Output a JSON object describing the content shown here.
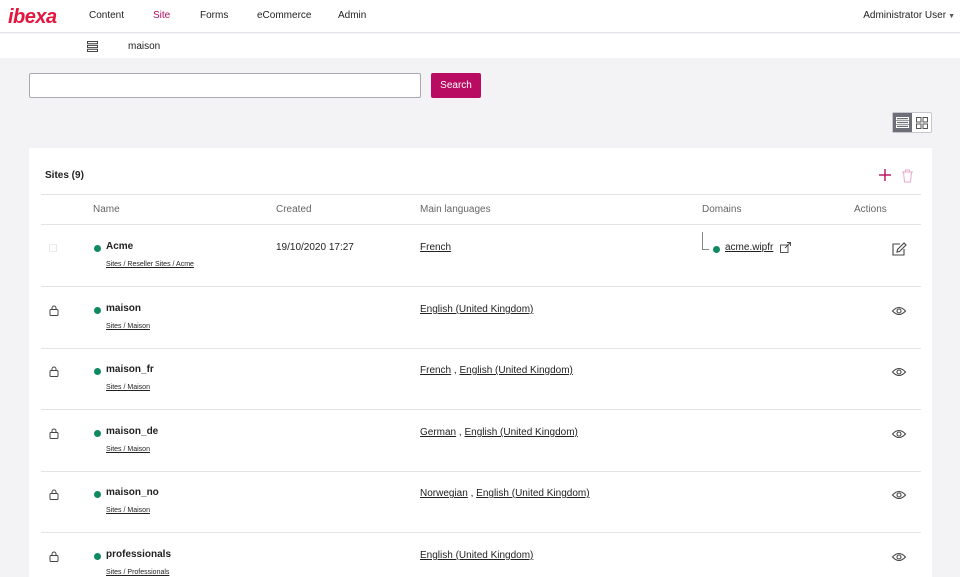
{
  "app": {
    "logo": "ibexa"
  },
  "nav": {
    "items": [
      {
        "label": "Content",
        "active": false
      },
      {
        "label": "Site",
        "active": true
      },
      {
        "label": "Forms",
        "active": false
      },
      {
        "label": "eCommerce",
        "active": false
      },
      {
        "label": "Admin",
        "active": false
      }
    ],
    "user": "Administrator User"
  },
  "breadcrumb": {
    "icon": "site-tree-icon",
    "text": "maison"
  },
  "search": {
    "value": "",
    "placeholder": "",
    "button_label": "Search"
  },
  "view_switch": {
    "active": "list",
    "options": [
      "list",
      "grid"
    ]
  },
  "colors": {
    "accent": "#b80b61",
    "logo": "#e3173e",
    "status": "#0f8a5f"
  },
  "sites": {
    "title": "Sites (9)",
    "columns": [
      "Name",
      "Created",
      "Main languages",
      "Domains",
      "Actions"
    ],
    "rows": [
      {
        "name": "Acme",
        "path": "Sites / Reseller Sites / Acme",
        "created": "19/10/2020 17:27",
        "languages": [
          "French"
        ],
        "domain": "acme.wipfr",
        "row_icon": "checkbox",
        "action": "edit-icon"
      },
      {
        "name": "maison",
        "path": "Sites / Maison",
        "created": "",
        "languages": [
          "English (United Kingdom)"
        ],
        "domain": "",
        "row_icon": "lock-icon",
        "action": "view-icon"
      },
      {
        "name": "maison_fr",
        "path": "Sites / Maison",
        "created": "",
        "languages": [
          "French",
          "English (United Kingdom)"
        ],
        "domain": "",
        "row_icon": "lock-icon",
        "action": "view-icon"
      },
      {
        "name": "maison_de",
        "path": "Sites / Maison",
        "created": "",
        "languages": [
          "German",
          "English (United Kingdom)"
        ],
        "domain": "",
        "row_icon": "lock-icon",
        "action": "view-icon"
      },
      {
        "name": "maison_no",
        "path": "Sites / Maison",
        "created": "",
        "languages": [
          "Norwegian",
          "English (United Kingdom)"
        ],
        "domain": "",
        "row_icon": "lock-icon",
        "action": "view-icon"
      },
      {
        "name": "professionals",
        "path": "Sites / Professionals",
        "created": "",
        "languages": [
          "English (United Kingdom)"
        ],
        "domain": "",
        "row_icon": "lock-icon",
        "action": "view-icon"
      }
    ]
  }
}
